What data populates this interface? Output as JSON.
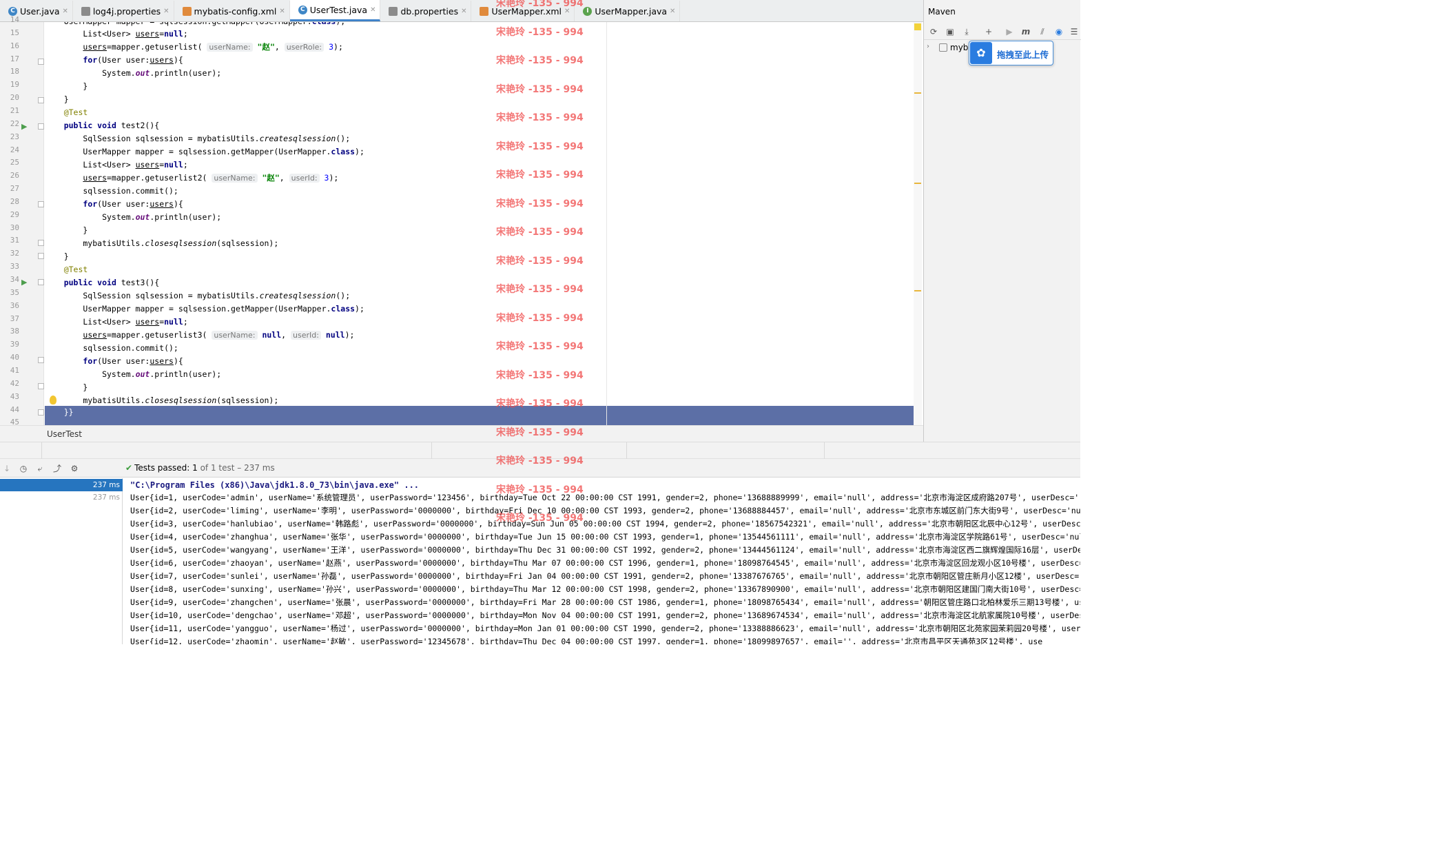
{
  "tabs": [
    {
      "label": "User.java",
      "icon": "c"
    },
    {
      "label": "log4j.properties",
      "icon": "p"
    },
    {
      "label": "mybatis-config.xml",
      "icon": "x"
    },
    {
      "label": "UserTest.java",
      "icon": "c",
      "active": true
    },
    {
      "label": "db.properties",
      "icon": "p"
    },
    {
      "label": "UserMapper.xml",
      "icon": "x"
    },
    {
      "label": "UserMapper.java",
      "icon": "i"
    }
  ],
  "editor": {
    "line_numbers": [
      "14",
      "15",
      "16",
      "17",
      "18",
      "19",
      "20",
      "21",
      "22",
      "23",
      "24",
      "25",
      "26",
      "27",
      "28",
      "29",
      "30",
      "31",
      "32",
      "33",
      "34",
      "35",
      "36",
      "37",
      "38",
      "39",
      "40",
      "41",
      "42",
      "43",
      "44",
      "45"
    ],
    "hints": {
      "userName": "userName:",
      "userRole": "userRole:",
      "userId": "userId:"
    },
    "breadcrumb": "UserTest"
  },
  "maven": {
    "title": "Maven",
    "project": "myba",
    "upload_label": "拖拽至此上传"
  },
  "run": {
    "passed_label": "Tests passed:",
    "passed_count": "1",
    "passed_detail": "of 1 test – 237 ms",
    "tree": [
      "237 ms",
      "237 ms"
    ],
    "console": [
      "\"C:\\Program Files (x86)\\Java\\jdk1.8.0_73\\bin\\java.exe\" ...",
      "User{id=1, userCode='admin', userName='系统管理员', userPassword='123456', birthday=Tue Oct 22 00:00:00 CST 1991, gender=2, phone='13688889999', email='null', address='北京市海淀区成府路207号', userDesc='',",
      "User{id=2, userCode='liming', userName='李明', userPassword='0000000', birthday=Fri Dec 10 00:00:00 CST 1993, gender=2, phone='13688884457', email='null', address='北京市东城区前门东大街9号', userDesc='null",
      "User{id=3, userCode='hanlubiao', userName='韩路彪', userPassword='0000000', birthday=Sun Jun 05 00:00:00 CST 1994, gender=2, phone='18567542321', email='null', address='北京市朝阳区北辰中心12号', userDesc='",
      "User{id=4, userCode='zhanghua', userName='张华', userPassword='0000000', birthday=Tue Jun 15 00:00:00 CST 1993, gender=1, phone='13544561111', email='null', address='北京市海淀区学院路61号', userDesc='null'",
      "User{id=5, userCode='wangyang', userName='王洋', userPassword='0000000', birthday=Thu Dec 31 00:00:00 CST 1992, gender=2, phone='13444561124', email='null', address='北京市海淀区西二旗辉煌国际16层', userDesc",
      "User{id=6, userCode='zhaoyan', userName='赵燕', userPassword='0000000', birthday=Thu Mar 07 00:00:00 CST 1996, gender=1, phone='18098764545', email='null', address='北京市海淀区回龙观小区10号楼', userDesc='",
      "User{id=7, userCode='sunlei', userName='孙磊', userPassword='0000000', birthday=Fri Jan 04 00:00:00 CST 1991, gender=2, phone='13387676765', email='null', address='北京市朝阳区管庄新月小区12楼', userDesc='n",
      "User{id=8, userCode='sunxing', userName='孙兴', userPassword='0000000', birthday=Thu Mar 12 00:00:00 CST 1998, gender=2, phone='13367890900', email='null', address='北京市朝阳区建国门南大街10号', userDesc='",
      "User{id=9, userCode='zhangchen', userName='张晨', userPassword='0000000', birthday=Fri Mar 28 00:00:00 CST 1986, gender=1, phone='18098765434', email='null', address='朝阳区管庄路口北柏林爱乐三期13号楼', use",
      "User{id=10, userCode='dengchao', userName='邓超', userPassword='0000000', birthday=Mon Nov 04 00:00:00 CST 1991, gender=2, phone='13689674534', email='null', address='北京市海淀区北航家属院10号楼', userDesc",
      "User{id=11, userCode='yangguo', userName='杨过', userPassword='0000000', birthday=Mon Jan 01 00:00:00 CST 1990, gender=2, phone='13388886623', email='null', address='北京市朝阳区北苑家园茉莉园20号楼', userDe",
      "User{id=12, userCode='zhaomin', userName='赵敏', userPassword='12345678', birthday=Thu Dec 04 00:00:00 CST 1997, gender=1, phone='18099897657', email='', address='北京市昌平区天通苑3区12号楼', use"
    ]
  },
  "watermark": "宋艳玲 -135 - 994"
}
